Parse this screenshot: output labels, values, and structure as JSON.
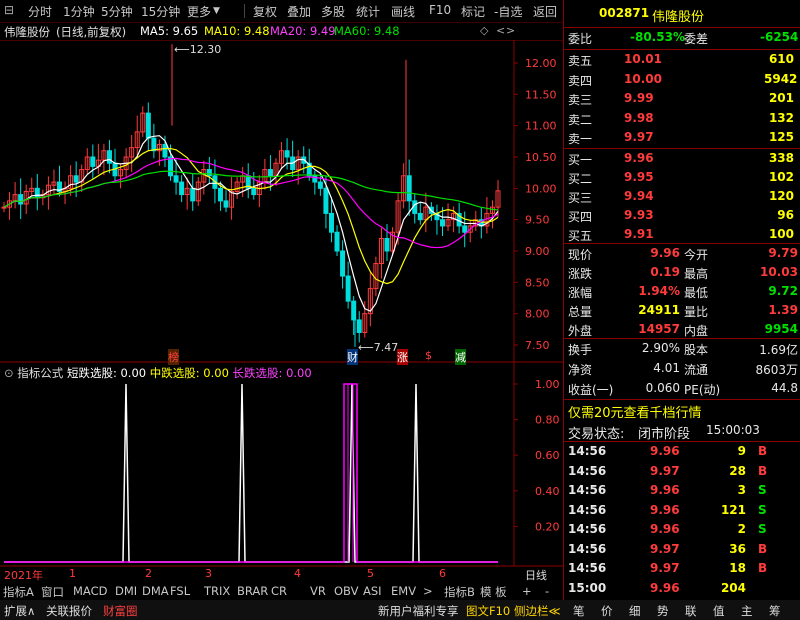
{
  "toolbar": {
    "items": [
      "分时",
      "1分钟",
      "5分钟",
      "15分钟",
      "更多",
      "复权",
      "叠加",
      "多股",
      "统计",
      "画线",
      "F10",
      "标记",
      "-自选",
      "返回"
    ]
  },
  "chart_header": {
    "stock_name": "伟隆股份",
    "mode": "(日线,前复权)",
    "ma5": "MA5: 9.65",
    "ma10": "MA10: 9.48",
    "ma20": "MA20: 9.49",
    "ma60": "MA60: 9.48"
  },
  "annotations": {
    "high": "12.30",
    "low": "7.47",
    "marks": [
      "榜",
      "财",
      "涨",
      "$",
      "减"
    ]
  },
  "indicator": {
    "title": "指标公式",
    "short": "短跌选股: 0.00",
    "mid": "中跌选股: 0.00",
    "long": "长跌选股: 0.00"
  },
  "x_axis": {
    "year": "2021年",
    "months": [
      "1",
      "2",
      "3",
      "4",
      "5",
      "6"
    ],
    "right_label": "日线"
  },
  "bottom_tabs": {
    "indicators": [
      "指标A",
      "窗口",
      "MACD",
      "DMI",
      "DMA",
      "FSL",
      "TRIX",
      "BRAR",
      "CR",
      "VR",
      "OBV",
      "ASI",
      "EMV",
      ">",
      "指标B",
      "模 板",
      "+",
      "-"
    ],
    "bar2": [
      "扩展∧",
      "关联报价",
      "财富圈"
    ],
    "bar2_right": [
      "新用户福利专享",
      "图文F10",
      "侧边栏≪"
    ],
    "panel_tabs": [
      "笔",
      "价",
      "细",
      "势",
      "联",
      "值",
      "主",
      "筹"
    ]
  },
  "quote": {
    "code": "002871",
    "name": "伟隆股份",
    "weibi_label": "委比",
    "weibi": "-80.53%",
    "weicha_label": "委差",
    "weicha": "-6254",
    "asks": [
      {
        "label": "卖五",
        "price": "10.01",
        "vol": "610"
      },
      {
        "label": "卖四",
        "price": "10.00",
        "vol": "5942"
      },
      {
        "label": "卖三",
        "price": "9.99",
        "vol": "201"
      },
      {
        "label": "卖二",
        "price": "9.98",
        "vol": "132"
      },
      {
        "label": "卖一",
        "price": "9.97",
        "vol": "125"
      }
    ],
    "bids": [
      {
        "label": "买一",
        "price": "9.96",
        "vol": "338"
      },
      {
        "label": "买二",
        "price": "9.95",
        "vol": "102"
      },
      {
        "label": "买三",
        "price": "9.94",
        "vol": "120"
      },
      {
        "label": "买四",
        "price": "9.93",
        "vol": "96"
      },
      {
        "label": "买五",
        "price": "9.91",
        "vol": "100"
      }
    ],
    "stats": [
      {
        "l1": "现价",
        "v1": "9.96",
        "l2": "今开",
        "v2": "9.79"
      },
      {
        "l1": "涨跌",
        "v1": "0.19",
        "l2": "最高",
        "v2": "10.03"
      },
      {
        "l1": "涨幅",
        "v1": "1.94%",
        "l2": "最低",
        "v2": "9.72"
      },
      {
        "l1": "总量",
        "v1": "24911",
        "l2": "量比",
        "v2": "1.39"
      },
      {
        "l1": "外盘",
        "v1": "14957",
        "l2": "内盘",
        "v2": "9954"
      }
    ],
    "fund": [
      {
        "l1": "换手",
        "v1": "2.90%",
        "l2": "股本",
        "v2": "1.69亿"
      },
      {
        "l1": "净资",
        "v1": "4.01",
        "l2": "流通",
        "v2": "8603万"
      },
      {
        "l1": "收益(一)",
        "v1": "0.060",
        "l2": "PE(动)",
        "v2": "44.8"
      }
    ],
    "promo": "仅需20元查看千档行情",
    "status_label": "交易状态:",
    "status": "闭市阶段",
    "status_time": "15:00:03",
    "ticks": [
      {
        "time": "14:56",
        "price": "9.96",
        "vol": "9",
        "bs": "B"
      },
      {
        "time": "14:56",
        "price": "9.97",
        "vol": "28",
        "bs": "B"
      },
      {
        "time": "14:56",
        "price": "9.96",
        "vol": "3",
        "bs": "S"
      },
      {
        "time": "14:56",
        "price": "9.96",
        "vol": "121",
        "bs": "S"
      },
      {
        "time": "14:56",
        "price": "9.96",
        "vol": "2",
        "bs": "S"
      },
      {
        "time": "14:56",
        "price": "9.97",
        "vol": "36",
        "bs": "B"
      },
      {
        "time": "14:56",
        "price": "9.97",
        "vol": "18",
        "bs": "B"
      },
      {
        "time": "15:00",
        "price": "9.96",
        "vol": "204",
        "bs": ""
      }
    ]
  },
  "colors": {
    "up": "#ff3b3b",
    "down": "#00e000",
    "ma5": "#ffffff",
    "ma10": "#ffff00",
    "ma20": "#ff00ff",
    "ma60": "#00e000",
    "border": "#8b0000"
  },
  "chart_data": [
    {
      "type": "candlestick",
      "title": "伟隆股份 (日线,前复权)",
      "y_ticks": [
        "12.00",
        "11.50",
        "11.00",
        "10.50",
        "10.00",
        "9.50",
        "9.00",
        "8.50",
        "8.00",
        "7.50"
      ],
      "ylim": [
        7.3,
        12.4
      ],
      "x_labels": [
        "2021年",
        "1",
        "2",
        "3",
        "4",
        "5",
        "6"
      ],
      "series": [
        {
          "name": "MA5",
          "last": 9.65
        },
        {
          "name": "MA10",
          "last": 9.48
        },
        {
          "name": "MA20",
          "last": 9.49
        },
        {
          "name": "MA60",
          "last": 9.48
        }
      ],
      "annotations": [
        {
          "label": "12.30",
          "value": 12.3
        },
        {
          "label": "7.47",
          "value": 7.47
        }
      ]
    },
    {
      "type": "line",
      "title": "指标公式",
      "y_ticks": [
        "1.00",
        "0.80",
        "0.60",
        "0.40",
        "0.20"
      ],
      "ylim": [
        0,
        1.05
      ],
      "series": [
        {
          "name": "短跌选股",
          "last": 0.0
        },
        {
          "name": "中跌选股",
          "last": 0.0
        },
        {
          "name": "长跌选股",
          "last": 0.0
        }
      ]
    }
  ]
}
